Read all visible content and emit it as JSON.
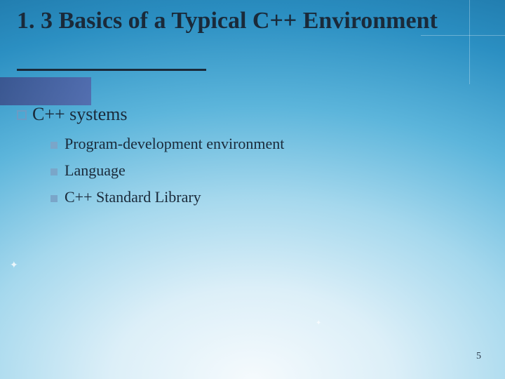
{
  "title": "1. 3 Basics of a Typical C++ Environment",
  "l1_text": "C++  systems",
  "sub": [
    "Program-development environment",
    "Language",
    "C++ Standard Library"
  ],
  "page_number": "5"
}
